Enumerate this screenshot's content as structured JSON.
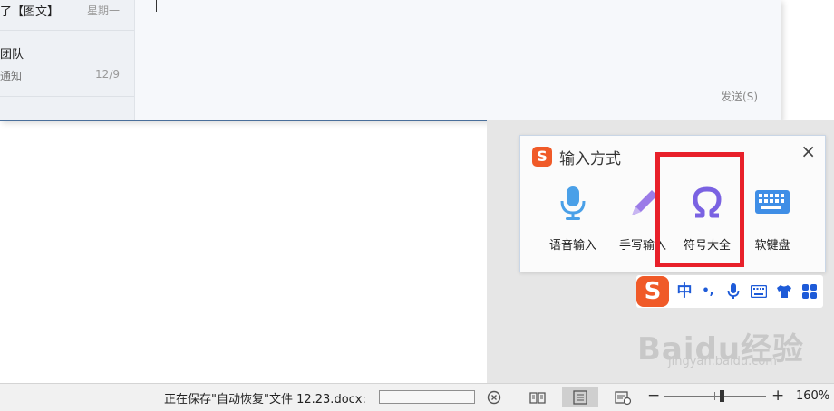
{
  "chat": {
    "items": [
      {
        "title": "了【图文】",
        "time": "星期一"
      },
      {
        "title": "团队",
        "subtitle": "通知",
        "time": "12/9"
      }
    ],
    "send_label": "发送(S)"
  },
  "ime_popup": {
    "title": "输入方式",
    "logo": "S",
    "close": "×",
    "items": [
      {
        "label": "语音输入",
        "icon": "microphone-icon"
      },
      {
        "label": "手写输入",
        "icon": "pen-icon"
      },
      {
        "label": "符号大全",
        "icon": "omega-icon"
      },
      {
        "label": "软键盘",
        "icon": "keyboard-icon"
      }
    ],
    "highlight_color": "#e8202a",
    "accent": "#f05a28"
  },
  "ime_toolbar": {
    "logo": "S",
    "lang": "中",
    "punct": "•,",
    "icons": [
      "microphone-icon",
      "keyboard-icon",
      "shirt-icon",
      "grid-icon"
    ],
    "color": "#1e5bd8"
  },
  "watermark": {
    "main": "Baidu经验",
    "url": "jingyan.baidu.com"
  },
  "statusbar": {
    "saving_text": "正在保存\"自动恢复\"文件 12.23.docx:",
    "progress": 0.0,
    "zoom_minus": "−",
    "zoom_plus": "+",
    "zoom": "160%"
  }
}
